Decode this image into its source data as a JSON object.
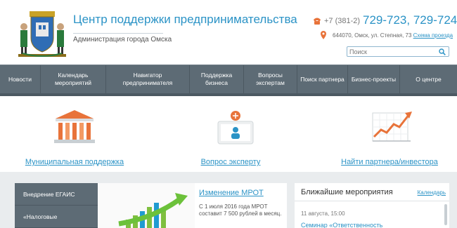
{
  "header": {
    "title": "Центр поддержки предпринимательства",
    "subtitle": "Администрация города Омска",
    "phone_code": "+7 (381-2)",
    "phone_numbers": "729-723, 729-724",
    "address": "644070, Омск, ул. Степная, 73",
    "map_link": "Схема проезда",
    "search_placeholder": "Поиск"
  },
  "nav": [
    {
      "label": "Новости"
    },
    {
      "label": "Календарь мероприятий"
    },
    {
      "label": "Навигатор предпринимателя"
    },
    {
      "label": "Поддержка бизнеса"
    },
    {
      "label": "Вопросы экспертам"
    },
    {
      "label": "Поиск партнера"
    },
    {
      "label": "Бизнес-проекты"
    },
    {
      "label": "О центре"
    }
  ],
  "featured": [
    {
      "label": "Муниципальная поддержка",
      "icon": "building-icon"
    },
    {
      "label": "Вопрос эксперту",
      "icon": "expert-icon"
    },
    {
      "label": "Найти партнера/инвестора",
      "icon": "growth-chart-icon"
    }
  ],
  "side_menu": [
    {
      "label": "Внедрение ЕГАИС"
    },
    {
      "label": "«Налоговые"
    }
  ],
  "news": {
    "title": "Изменение МРОТ",
    "text": "С 1 июля 2016 года МРОТ составит 7 500 рублей в месяц."
  },
  "events": {
    "title": "Ближайшие мероприятия",
    "calendar_link": "Календарь",
    "date": "11 августа, 15:00",
    "item": "Семинар «Ответственность"
  },
  "colors": {
    "accent": "#2b93c6",
    "nav_bg": "#5d6b75",
    "icon_orange": "#e8733a",
    "lower_bg": "#e9ecee"
  }
}
